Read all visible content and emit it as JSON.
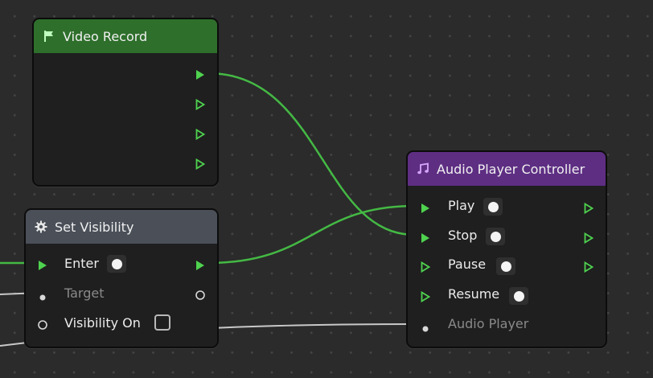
{
  "colors": {
    "background": "#2b2b2b",
    "flow_port": "#4fd24f",
    "wire_flow": "#44b944",
    "wire_data": "#c8c8c8",
    "header_video": "#2e6f2b",
    "header_visibility": "#4a4f58",
    "header_audio": "#5e2e83"
  },
  "nodes": {
    "video_record": {
      "title": "Video Record",
      "icon": "flag-icon"
    },
    "set_visibility": {
      "title": "Set Visibility",
      "icon": "gear-icon",
      "inputs": [
        {
          "label": "Enter",
          "port": "flow",
          "value_knob": true
        },
        {
          "label": "Target",
          "port": "data-dot",
          "dim": true
        },
        {
          "label": "Visibility On",
          "port": "data-ring",
          "checkbox": true
        }
      ]
    },
    "audio_player_controller": {
      "title": "Audio Player Controller",
      "icon": "music-note-icon",
      "inputs": [
        {
          "label": "Play",
          "port": "flow"
        },
        {
          "label": "Stop",
          "port": "flow"
        },
        {
          "label": "Pause",
          "port": "flow-outline"
        },
        {
          "label": "Resume",
          "port": "flow-outline"
        },
        {
          "label": "Audio Player",
          "port": "data-dot",
          "dim": true
        }
      ]
    }
  }
}
